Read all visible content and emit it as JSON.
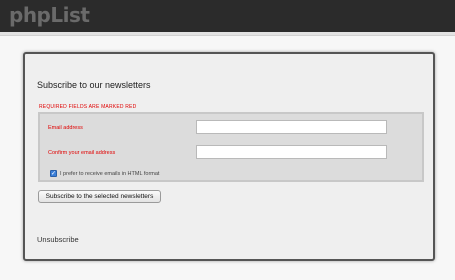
{
  "header": {
    "logo": "phpList"
  },
  "form": {
    "title": "Subscribe to our newsletters",
    "required_note": "REQUIRED FIELDS ARE MARKED RED",
    "email_label": "Email address",
    "email_value": "",
    "confirm_label": "Confirm your email address",
    "confirm_value": "",
    "html_checkbox": {
      "checked": true,
      "label": "I prefer to receive emails in HTML format"
    },
    "subscribe_button": "Subscribe to the selected newsletters",
    "unsubscribe_link": "Unsubscribe"
  },
  "colors": {
    "required": "#e00000",
    "topbar": "#2b2b2b",
    "checkbox": "#3b7fd9"
  }
}
